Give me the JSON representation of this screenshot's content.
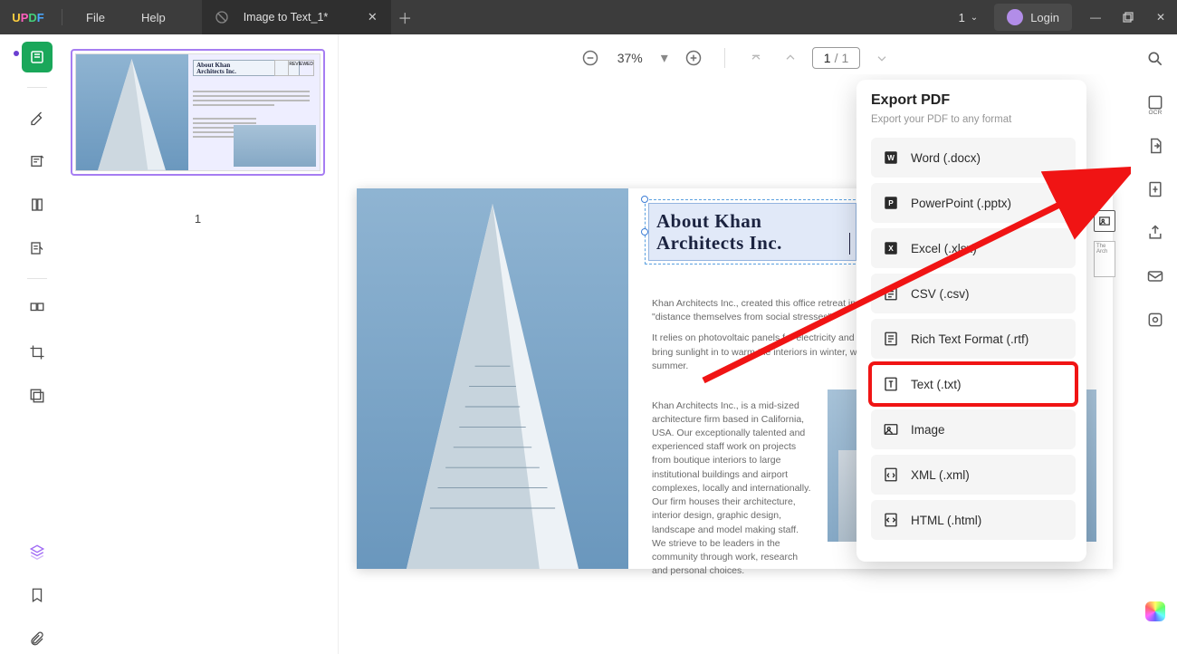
{
  "titlebar": {
    "logo_letters": {
      "u": "U",
      "p": "P",
      "d": "D",
      "f": "F"
    },
    "menu": {
      "file": "File",
      "help": "Help"
    },
    "tab": {
      "title": "Image to Text_1*"
    },
    "one_dropdown": "1",
    "login_label": "Login"
  },
  "toolbar": {
    "zoom": "37%",
    "page_current": "1",
    "page_sep": "/",
    "page_total": "1"
  },
  "thumb": {
    "page_num": "1",
    "title_line1": "About Khan",
    "title_line2": "Architects Inc.",
    "reviewed_label": "REVIEWED"
  },
  "document": {
    "title_line1": "About Khan",
    "title_line2": "Architects Inc.",
    "para1": "Khan Architects Inc., created this office retreat in Westport, Washington for a couple to relax and \"distance themselves from social stresses\".",
    "para2": "It relies on photovoltaic panels for electricity and passive building designs to regulate temperature that bring sunlight in to warm the interiors in winter, while an extended west-facing wall gives shade in the summer.",
    "para3": "Khan Architects Inc., is a mid-sized architecture firm based in California, USA. Our exceptionally talented and experienced staff work on projects from boutique interiors to large institutional buildings and airport complexes, locally and internationally. Our firm houses their architecture, interior design, graphic design, landscape and model making staff. We strieve to be leaders in the community through work, research and personal choices.",
    "sidebox": "The Arch"
  },
  "export": {
    "title": "Export PDF",
    "subtitle": "Export your PDF to any format",
    "items": {
      "word": "Word (.docx)",
      "ppt": "PowerPoint (.pptx)",
      "excel": "Excel (.xlsx)",
      "csv": "CSV (.csv)",
      "rtf": "Rich Text Format (.rtf)",
      "txt": "Text (.txt)",
      "image": "Image",
      "xml": "XML (.xml)",
      "html": "HTML (.html)"
    }
  }
}
